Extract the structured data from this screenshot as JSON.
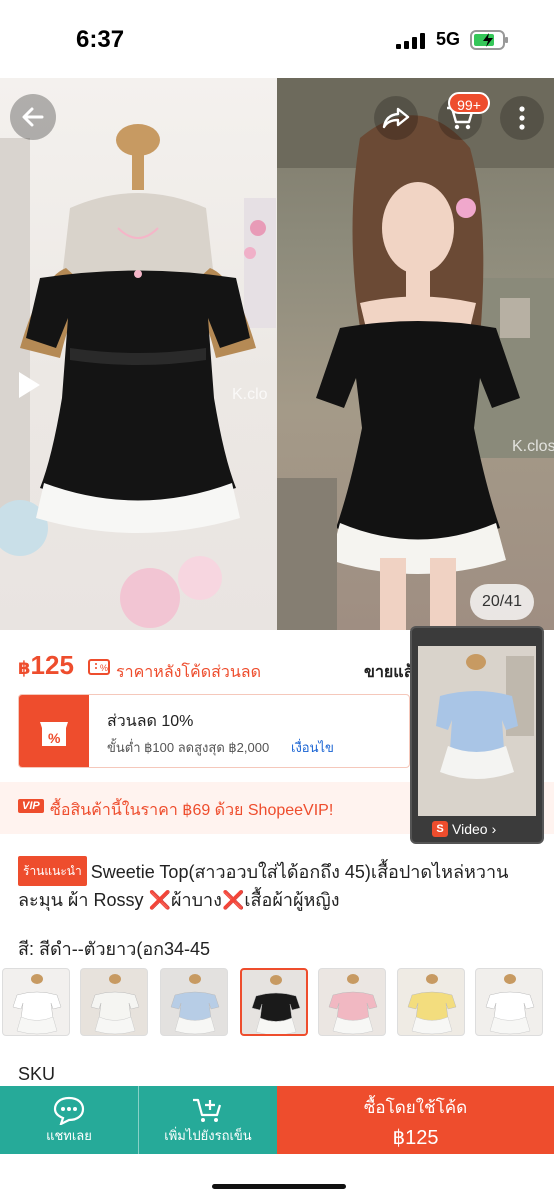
{
  "status_bar": {
    "time": "6:37",
    "network": "5G"
  },
  "hero": {
    "watermark": "K.clo",
    "watermark_right": "K.clos",
    "image_counter": "20/41",
    "cart_count": "99+"
  },
  "price": {
    "currency": "฿",
    "amount": "125",
    "note": "ราคาหลังโค้ดส่วนลด",
    "sold_label": "ขายแล้"
  },
  "voucher": {
    "title": "ส่วนลด 10%",
    "conditions": "ขั้นต่ำ ฿100 ลดสูงสุด ฿2,000",
    "link": "เงื่อนไข"
  },
  "vip": {
    "badge": "VIP",
    "text": "ซื้อสินค้านี้ในราคา ฿69 ด้วย ShopeeVIP!"
  },
  "video_card": {
    "label": "Video"
  },
  "product": {
    "badge": "ร้านแนะนำ",
    "title_part1": "Sweetie Top(สาวอวบใส่ได้อกถึง 45)เสื้อปาดไหล่หวานละมุน ผ้า Rossy ",
    "title_part2": "ผ้าบาง",
    "title_part3": "เสื้อผ้าผู้หญิง",
    "xmark": "❌",
    "variant_label": "สี: สีดำ--ตัวยาว(อก34-45",
    "sku_label": "SKU"
  },
  "thumbnails": [
    {
      "color": "#f2f0ee",
      "dress": "#ffffff"
    },
    {
      "color": "#e7e2dc",
      "dress": "#f5f5f2"
    },
    {
      "color": "#e3e1df",
      "dress": "#b7cde6"
    },
    {
      "color": "#e6e3e0",
      "dress": "#1a1a1a"
    },
    {
      "color": "#ebe6e2",
      "dress": "#f1b8c2"
    },
    {
      "color": "#efebe4",
      "dress": "#f3dd7e"
    },
    {
      "color": "#f1efec",
      "dress": "#ffffff"
    }
  ],
  "bottom_bar": {
    "chat_label": "แชทเลย",
    "add_cart_label": "เพิ่มไปยังรถเข็น",
    "buy_label": "ซื้อโดยใช้โค้ด",
    "buy_price": "฿125"
  },
  "colors": {
    "accent": "#ee4d2d",
    "teal": "#26aa99",
    "link": "#1a64d3"
  }
}
